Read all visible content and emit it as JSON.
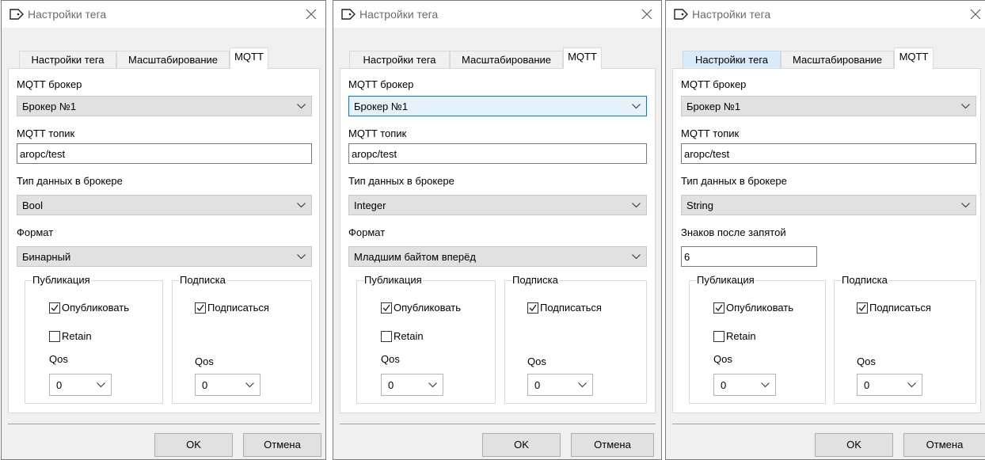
{
  "dialogs": [
    {
      "title": "Настройки тега",
      "tabs": [
        "Настройки тега",
        "Масштабирование",
        "MQTT"
      ],
      "broker_label": "MQTT брокер",
      "broker_value": "Брокер №1",
      "topic_label": "MQTT топик",
      "topic_value": "aropc/test",
      "type_label": "Тип данных в брокере",
      "type_value": "Bool",
      "format_label": "Формат",
      "format_value": "Бинарный",
      "publication": {
        "title": "Публикация",
        "publish_label": "Опубликовать",
        "publish_checked": true,
        "retain_label": "Retain",
        "retain_checked": false,
        "qos_label": "Qos",
        "qos_value": "0"
      },
      "subscription": {
        "title": "Подписка",
        "subscribe_label": "Подписаться",
        "subscribe_checked": true,
        "qos_label": "Qos",
        "qos_value": "0"
      },
      "ok_label": "OK",
      "cancel_label": "Отмена"
    },
    {
      "title": "Настройки тега",
      "tabs": [
        "Настройки тега",
        "Масштабирование",
        "MQTT"
      ],
      "broker_label": "MQTT брокер",
      "broker_value": "Брокер №1",
      "topic_label": "MQTT топик",
      "topic_value": "aropc/test",
      "type_label": "Тип данных в брокере",
      "type_value": "Integer",
      "format_label": "Формат",
      "format_value": "Младшим байтом вперёд",
      "publication": {
        "title": "Публикация",
        "publish_label": "Опубликовать",
        "publish_checked": true,
        "retain_label": "Retain",
        "retain_checked": false,
        "qos_label": "Qos",
        "qos_value": "0"
      },
      "subscription": {
        "title": "Подписка",
        "subscribe_label": "Подписаться",
        "subscribe_checked": true,
        "qos_label": "Qos",
        "qos_value": "0"
      },
      "ok_label": "OK",
      "cancel_label": "Отмена"
    },
    {
      "title": "Настройки тега",
      "tabs": [
        "Настройки тега",
        "Масштабирование",
        "MQTT"
      ],
      "broker_label": "MQTT брокер",
      "broker_value": "Брокер №1",
      "topic_label": "MQTT топик",
      "topic_value": "aropc/test",
      "type_label": "Тип данных в брокере",
      "type_value": "String",
      "decimals_label": "Знаков после запятой",
      "decimals_value": "6",
      "publication": {
        "title": "Публикация",
        "publish_label": "Опубликовать",
        "publish_checked": true,
        "retain_label": "Retain",
        "retain_checked": false,
        "qos_label": "Qos",
        "qos_value": "0"
      },
      "subscription": {
        "title": "Подписка",
        "subscribe_label": "Подписаться",
        "subscribe_checked": true,
        "qos_label": "Qos",
        "qos_value": "0"
      },
      "ok_label": "OK",
      "cancel_label": "Отмена"
    }
  ],
  "colors": {
    "window_bg": "#f0f0f0",
    "panel_bg": "#ffffff",
    "combo_bg": "#e1e1e1",
    "focus_border": "#0078d7",
    "tab_hover": "#d9ebf9"
  },
  "icons": {
    "title_icon": "tag-icon",
    "close": "close-icon",
    "dropdown": "chevron-down-icon",
    "check": "checkmark-icon"
  }
}
